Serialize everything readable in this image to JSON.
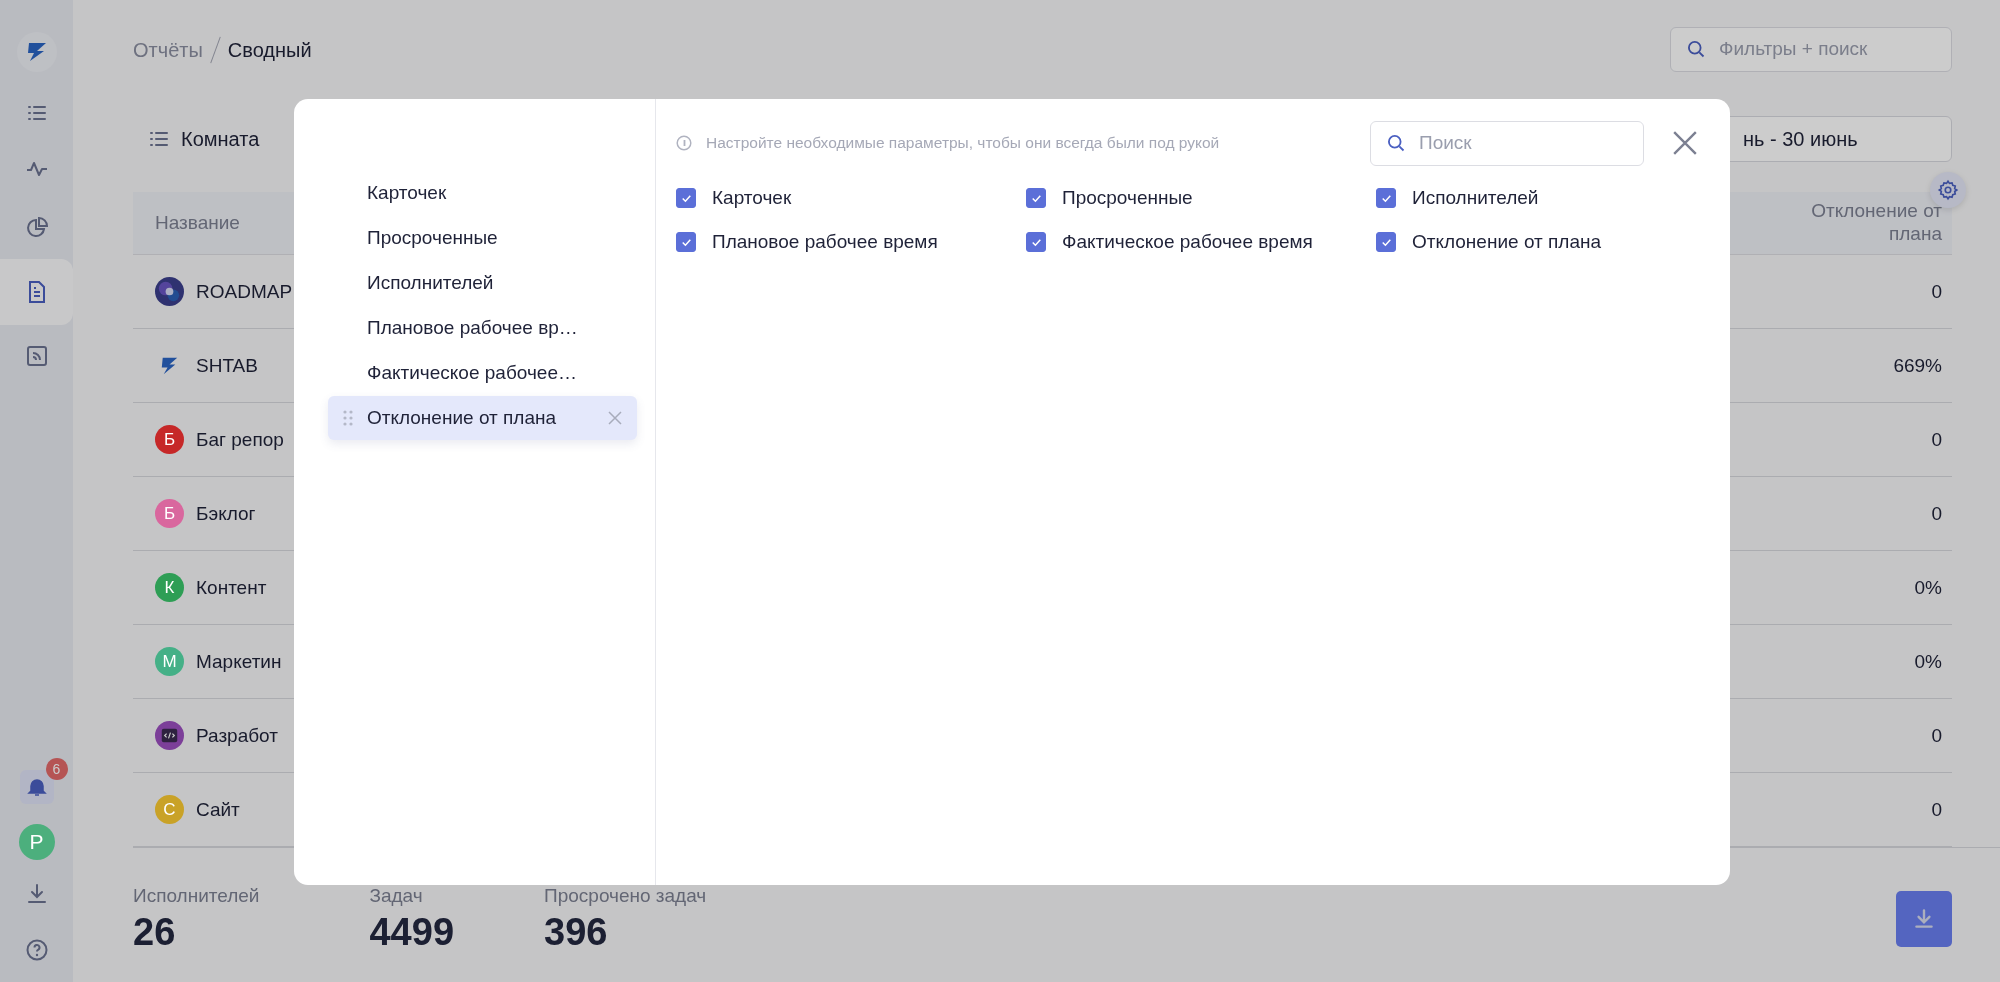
{
  "sidebar": {
    "items": [
      {
        "kind": "list",
        "selected": false
      },
      {
        "kind": "pulse",
        "selected": false
      },
      {
        "kind": "pie",
        "selected": false
      },
      {
        "kind": "document",
        "selected": true
      },
      {
        "kind": "feed",
        "selected": false
      }
    ],
    "notifications": {
      "count": "6"
    },
    "avatar": {
      "letter": "Р",
      "color": "#4caf7d"
    }
  },
  "breadcrumbs": [
    "Отчёты",
    "Сводный"
  ],
  "filter_search": {
    "placeholder": "Фильтры + поиск"
  },
  "toolbar": {
    "group_label": "Комната",
    "date_range": "нь - 30 июнь"
  },
  "table": {
    "columns": [
      "Название",
      "Отклонение от\nплана"
    ],
    "rows": [
      {
        "name": "ROADMAP",
        "avatar": {
          "kind": "image"
        },
        "value": "0"
      },
      {
        "name": "SHTAB",
        "avatar": {
          "kind": "logo"
        },
        "value": "669%"
      },
      {
        "name": "Баг репор",
        "avatar": {
          "kind": "letter",
          "letter": "Б",
          "color": "#c62828"
        },
        "value": "0"
      },
      {
        "name": "Бэклог",
        "avatar": {
          "kind": "letter",
          "letter": "Б",
          "color": "#d9679e"
        },
        "value": "0"
      },
      {
        "name": "Контент",
        "avatar": {
          "kind": "letter",
          "letter": "К",
          "color": "#2e9e55"
        },
        "value": "0%"
      },
      {
        "name": "Маркетин",
        "avatar": {
          "kind": "letter",
          "letter": "М",
          "color": "#45b087"
        },
        "value": "0%"
      },
      {
        "name": "Разработ",
        "avatar": {
          "kind": "code"
        },
        "value": "0"
      },
      {
        "name": "Сайт",
        "avatar": {
          "kind": "letter",
          "letter": "С",
          "color": "#c9a227"
        },
        "value": "0"
      }
    ]
  },
  "stats": [
    {
      "label": "Исполнителей",
      "value": "26"
    },
    {
      "label": "Задач",
      "value": "4499"
    },
    {
      "label": "Просрочено задач",
      "value": "396"
    }
  ],
  "modal": {
    "hint": "Настройте необходимые параметры, чтобы они всегда были под рукой",
    "search": {
      "placeholder": "Поиск"
    },
    "selected_columns": [
      {
        "label": "Карточек",
        "selected": false
      },
      {
        "label": "Просроченные",
        "selected": false
      },
      {
        "label": "Исполнителей",
        "selected": false
      },
      {
        "label": "Плановое рабочее вр…",
        "selected": false
      },
      {
        "label": "Фактическое рабочее…",
        "selected": false
      },
      {
        "label": "Отклонение от плана",
        "selected": true
      }
    ],
    "options": [
      {
        "label": "Карточек",
        "checked": true
      },
      {
        "label": "Просроченные",
        "checked": true
      },
      {
        "label": "Исполнителей",
        "checked": true
      },
      {
        "label": "Плановое рабочее время",
        "checked": true
      },
      {
        "label": "Фактическое рабочее время",
        "checked": true
      },
      {
        "label": "Отклонение от плана",
        "checked": true
      }
    ]
  }
}
